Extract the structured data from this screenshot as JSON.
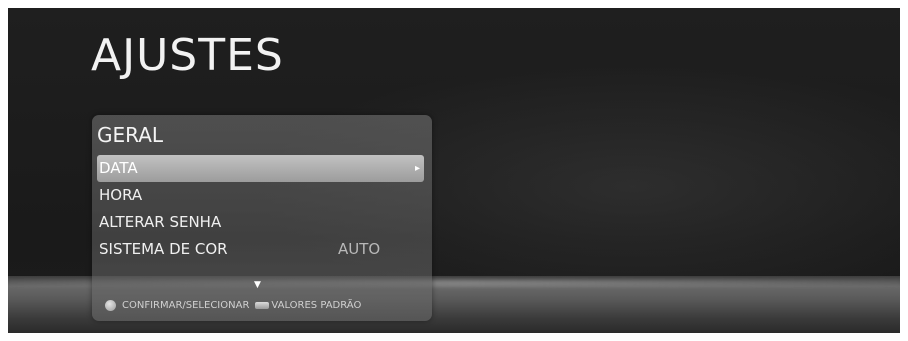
{
  "page": {
    "title": "AJUSTES"
  },
  "panel": {
    "title": "GERAL",
    "items": [
      {
        "label": "DATA",
        "value": "",
        "selected": true,
        "has_submenu": true
      },
      {
        "label": "HORA",
        "value": ""
      },
      {
        "label": "ALTERAR SENHA",
        "value": ""
      },
      {
        "label": "SISTEMA DE COR",
        "value": "AUTO"
      }
    ],
    "submenu_arrow": "▸",
    "more_arrow": "▼"
  },
  "help": {
    "confirm_label": "CONFIRMAR/SELECIONAR",
    "defaults_label": "VALORES PADRÃO",
    "confirm_icon": "circle-button-icon",
    "defaults_icon": "rectangle-button-icon"
  },
  "colors": {
    "background": "#1c1c1c",
    "selection": "#b0b0b0",
    "text": "#f0f0f0"
  }
}
